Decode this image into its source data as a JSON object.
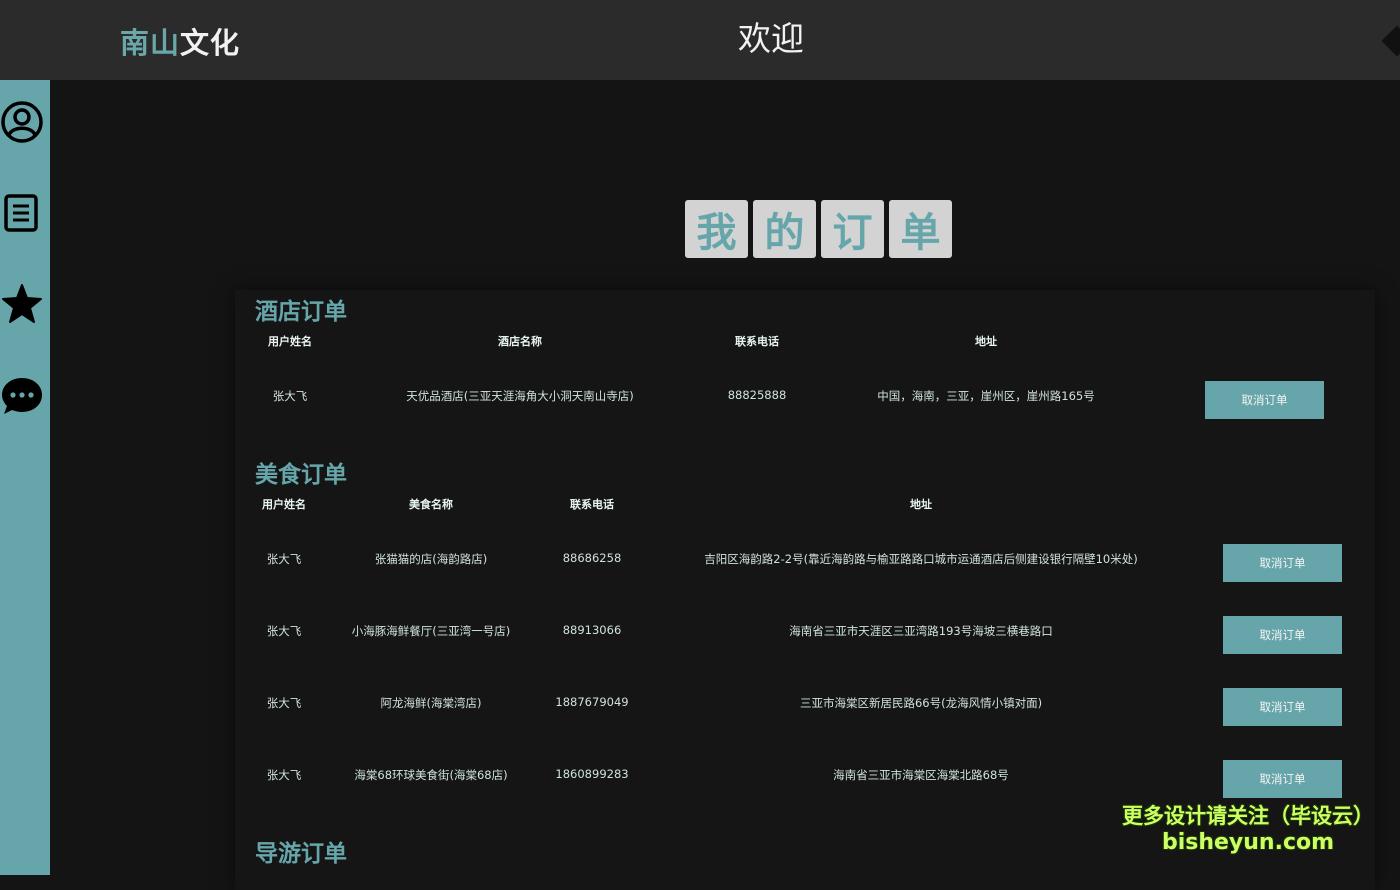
{
  "header": {
    "logo_part1": "南山",
    "logo_part2": "文化",
    "welcome": "欢迎"
  },
  "sidebar": {
    "icons": [
      "user-icon",
      "document-icon",
      "star-icon",
      "chat-icon"
    ]
  },
  "page": {
    "title_chars": [
      "我",
      "的",
      "订",
      "单"
    ]
  },
  "hotel": {
    "title": "酒店订单",
    "columns": [
      "用户姓名",
      "酒店名称",
      "联系电话",
      "地址"
    ],
    "rows": [
      {
        "user": "张大飞",
        "name": "天优品酒店(三亚天涯海角大小洞天南山寺店)",
        "phone": "88825888",
        "address": "中国，海南，三亚，崖州区，崖州路165号",
        "action": "取消订单"
      }
    ]
  },
  "food": {
    "title": "美食订单",
    "columns": [
      "用户姓名",
      "美食名称",
      "联系电话",
      "地址"
    ],
    "rows": [
      {
        "user": "张大飞",
        "name": "张猫猫的店(海韵路店)",
        "phone": "88686258",
        "address": "吉阳区海韵路2-2号(靠近海韵路与榆亚路路口城市运通酒店后侧建设银行隔壁10米处)",
        "action": "取消订单"
      },
      {
        "user": "张大飞",
        "name": "小海豚海鲜餐厅(三亚湾一号店)",
        "phone": "88913066",
        "address": "海南省三亚市天涯区三亚湾路193号海坡三横巷路口",
        "action": "取消订单"
      },
      {
        "user": "张大飞",
        "name": "阿龙海鲜(海棠湾店)",
        "phone": "1887679049",
        "address": "三亚市海棠区新居民路66号(龙海风情小镇对面)",
        "action": "取消订单"
      },
      {
        "user": "张大飞",
        "name": "海棠68环球美食街(海棠68店)",
        "phone": "1860899283",
        "address": "海南省三亚市海棠区海棠北路68号",
        "action": "取消订单"
      }
    ]
  },
  "guide": {
    "title": "导游订单"
  },
  "watermark": {
    "line1": "更多设计请关注（毕设云）",
    "line2": "bisheyun.com"
  }
}
